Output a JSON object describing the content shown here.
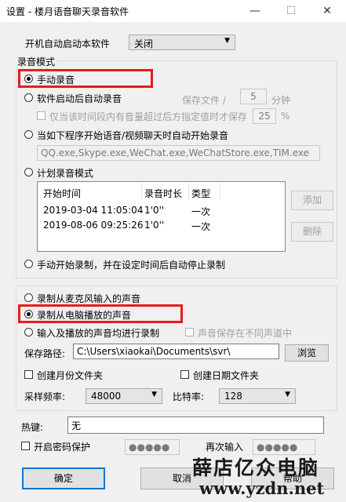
{
  "window": {
    "title": "设置 - 楼月语音聊天录音软件",
    "minimize": "—",
    "maximize": "☐",
    "close": "✕"
  },
  "autostart": {
    "label": "开机自动启动本软件",
    "value": "关闭"
  },
  "record_mode": {
    "group_label": "录音模式",
    "manual": "手动录音",
    "auto_after_start": "软件启动后自动录音",
    "save_file_label": "保存文件 /",
    "save_file_value": "5",
    "save_file_unit": "分钟",
    "only_save_label": "仅当该时间段内有音量超过后方指定值时才保存",
    "only_save_value": "25",
    "only_save_unit": "%",
    "programs_label": "当如下程序开始语音/视频聊天时自动开始录音",
    "programs_value": "QQ.exe,Skype.exe,WeChat.exe,WeChatStore.exe,TIM.exe",
    "scheduled_label": "计划录音模式",
    "table_headers": [
      "开始时间",
      "录音时长",
      "类型"
    ],
    "table_rows": [
      [
        "2019-03-04 11:05:04",
        "1'0''",
        "一次"
      ],
      [
        "2019-08-06 09:25:26",
        "1'0''",
        "一次"
      ]
    ],
    "add_button": "添加",
    "delete_button": "删除",
    "manual_start_auto_stop": "手动开始录制，并在设定时间后自动停止录制"
  },
  "source": {
    "mic": "录制从麦克风输入的声音",
    "computer": "录制从电脑播放的声音",
    "both": "输入及播放的声音均进行录制",
    "separate_channel": "声音保存在不同声道中",
    "save_path_label": "保存路径:",
    "save_path_value": "C:\\Users\\xiaokai\\Documents\\svr\\",
    "browse_button": "浏览",
    "month_folder": "创建月份文件夹",
    "date_folder": "创建日期文件夹",
    "sample_rate_label": "采样频率:",
    "sample_rate_value": "48000",
    "bitrate_label": "比特率:",
    "bitrate_value": "128"
  },
  "hotkey": {
    "label": "热键:",
    "value": "无"
  },
  "password": {
    "enable_label": "开启密码保护",
    "value": "●●●●●",
    "repeat_label": "再次输入",
    "repeat_value": "●●●●●"
  },
  "buttons": {
    "ok": "确定",
    "cancel": "取消",
    "help": "帮助"
  },
  "watermark": {
    "brand": "薛店亿众电脑",
    "url": "www.yzdn.net"
  },
  "colors": {
    "highlight_box": "#e41e1e",
    "watermark_text": "#1a1a1a"
  }
}
